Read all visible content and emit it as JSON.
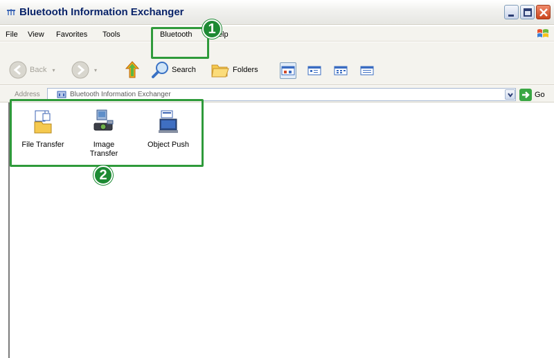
{
  "window": {
    "title": "Bluetooth Information Exchanger"
  },
  "menubar": {
    "items": [
      "File",
      "View",
      "Favorites",
      "Tools",
      "Bluetooth",
      "Help"
    ]
  },
  "toolbar": {
    "back_label": "Back",
    "search_label": "Search",
    "folders_label": "Folders"
  },
  "addressbar": {
    "label": "Address",
    "value": "Bluetooth Information Exchanger",
    "go_label": "Go"
  },
  "content": {
    "items": [
      {
        "label": "File Transfer",
        "icon": "file-transfer-icon"
      },
      {
        "label": "Image Transfer",
        "icon": "image-transfer-icon"
      },
      {
        "label": "Object Push",
        "icon": "object-push-icon"
      }
    ]
  },
  "annotations": {
    "callout_1": "1",
    "callout_2": "2",
    "highlight_color": "#2e9a3a"
  }
}
